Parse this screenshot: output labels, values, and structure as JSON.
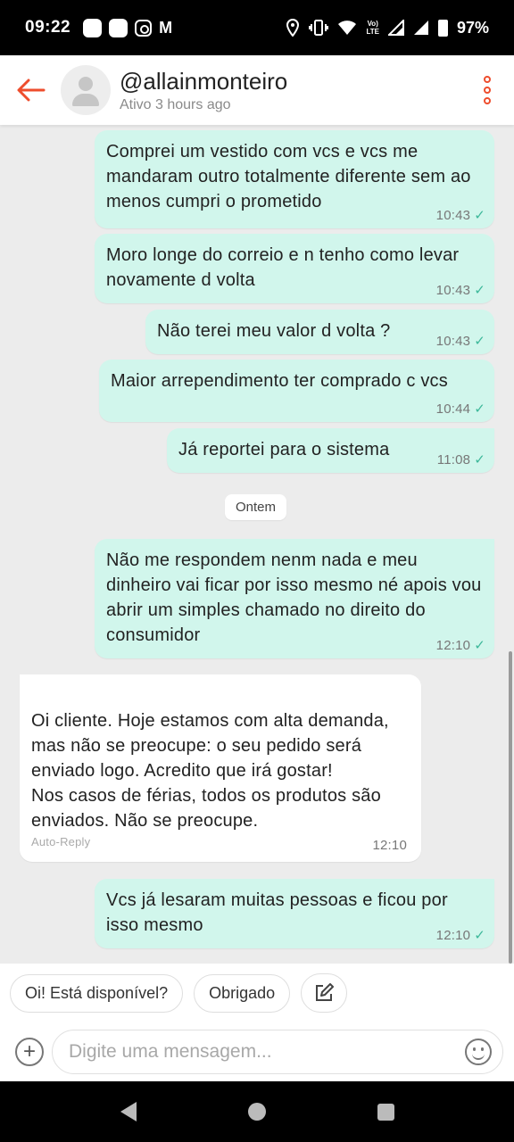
{
  "status_bar": {
    "time": "09:22",
    "battery": "97%",
    "network": "Vo) LTE"
  },
  "header": {
    "username": "@allainmonteiro",
    "last_seen": "Ativo 3 hours ago",
    "accent_color": "#ee4d2d"
  },
  "messages": [
    {
      "text": "Comprei um vestido com vcs e vcs me mandaram outro totalmente diferente sem ao menos cumpri o prometido",
      "time": "10:43"
    },
    {
      "text": "Moro longe do correio e n tenho como levar novamente d volta",
      "time": "10:43"
    },
    {
      "text": "Não terei meu valor d volta ?",
      "time": "10:43"
    },
    {
      "text": "Maior arrependimento ter comprado c vcs",
      "time": "10:44"
    },
    {
      "text": "Já reportei para o sistema",
      "time": "11:08"
    },
    {
      "text": "Não me respondem nenm nada e meu dinheiro vai ficar por isso mesmo né apois vou abrir um simples chamado no direito do consumidor",
      "time": "12:10"
    },
    {
      "text": "Oi cliente. Hoje estamos com alta demanda, mas não se preocupe: o seu pedido será enviado logo. Acredito que irá gostar!\nNos casos de férias, todos os produtos são enviados. Não se preocupe.",
      "time": "12:10",
      "label": "Auto-Reply"
    },
    {
      "text": "Vcs já lesaram muitas pessoas e ficou por isso mesmo",
      "time": "12:10"
    }
  ],
  "date_divider": "Ontem",
  "quick_replies": [
    "Oi! Está disponível?",
    "Obrigado"
  ],
  "input": {
    "placeholder": "Digite uma mensagem..."
  },
  "colors": {
    "outgoing_bubble": "#d1f6ec",
    "incoming_bubble": "#ffffff",
    "read_check": "#3db89a"
  }
}
